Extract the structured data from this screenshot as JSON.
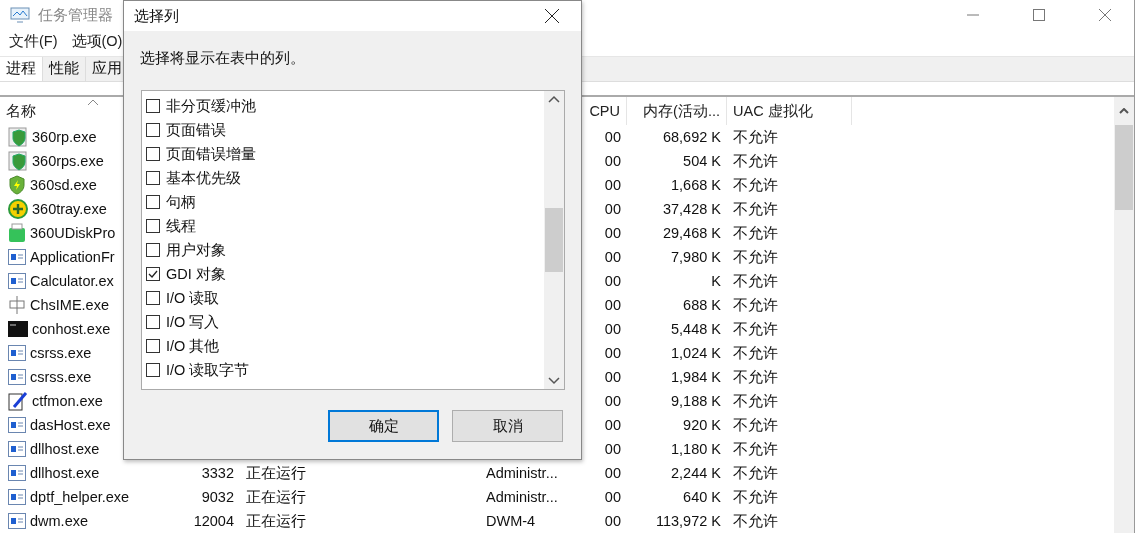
{
  "window": {
    "title": "任务管理器"
  },
  "menu": [
    "文件(F)",
    "选项(O)"
  ],
  "tabs": [
    {
      "label": "进程",
      "selected": true
    },
    {
      "label": "性能",
      "selected": false
    },
    {
      "label": "应用",
      "selected": false
    }
  ],
  "table": {
    "columns": [
      "名称",
      "CPU",
      "内存(活动...",
      "UAC 虚拟化"
    ],
    "rows": [
      {
        "kind": "shield-window",
        "name": "360rp.exe",
        "cpu": "00",
        "memory": "68,692 K",
        "uac": "不允许"
      },
      {
        "kind": "shield-window",
        "name": "360rps.exe",
        "cpu": "00",
        "memory": "504 K",
        "uac": "不允许"
      },
      {
        "kind": "shield",
        "name": "360sd.exe",
        "cpu": "00",
        "memory": "1,668 K",
        "uac": "不允许"
      },
      {
        "kind": "tray",
        "name": "360tray.exe",
        "cpu": "00",
        "memory": "37,428 K",
        "uac": "不允许"
      },
      {
        "kind": "usb",
        "name": "360UDiskPro",
        "cpu": "00",
        "memory": "29,468 K",
        "uac": "不允许"
      },
      {
        "kind": "app",
        "name": "ApplicationFr",
        "cpu": "00",
        "memory": "7,980 K",
        "uac": "不允许"
      },
      {
        "kind": "app",
        "name": "Calculator.ex",
        "cpu": "00",
        "memory": "K",
        "uac": "不允许"
      },
      {
        "kind": "ime",
        "name": "ChsIME.exe",
        "cpu": "00",
        "memory": "688 K",
        "uac": "不允许"
      },
      {
        "kind": "console",
        "name": "conhost.exe",
        "cpu": "00",
        "memory": "5,448 K",
        "uac": "不允许"
      },
      {
        "kind": "app",
        "name": "csrss.exe",
        "cpu": "00",
        "memory": "1,024 K",
        "uac": "不允许"
      },
      {
        "kind": "app",
        "name": "csrss.exe",
        "cpu": "00",
        "memory": "1,984 K",
        "uac": "不允许"
      },
      {
        "kind": "pen",
        "name": "ctfmon.exe",
        "cpu": "00",
        "memory": "9,188 K",
        "uac": "不允许"
      },
      {
        "kind": "app",
        "name": "dasHost.exe",
        "cpu": "00",
        "memory": "920 K",
        "uac": "不允许"
      },
      {
        "kind": "app",
        "name": "dllhost.exe",
        "cpu": "00",
        "memory": "1,180 K",
        "uac": "不允许"
      },
      {
        "kind": "app",
        "name": "dllhost.exe",
        "pid": "3332",
        "status": "正在运行",
        "user": "Administr...",
        "cpu": "00",
        "memory": "2,244 K",
        "uac": "不允许"
      },
      {
        "kind": "app",
        "name": "dptf_helper.exe",
        "pid": "9032",
        "status": "正在运行",
        "user": "Administr...",
        "cpu": "00",
        "memory": "640 K",
        "uac": "不允许"
      },
      {
        "kind": "app",
        "name": "dwm.exe",
        "pid": "12004",
        "status": "正在运行",
        "user": "DWM-4",
        "cpu": "00",
        "memory": "113,972 K",
        "uac": "不允许"
      }
    ]
  },
  "dialog": {
    "title": "选择列",
    "message": "选择将显示在表中的列。",
    "options": [
      {
        "label": "非分页缓冲池",
        "checked": false
      },
      {
        "label": "页面错误",
        "checked": false
      },
      {
        "label": "页面错误增量",
        "checked": false
      },
      {
        "label": "基本优先级",
        "checked": false
      },
      {
        "label": "句柄",
        "checked": false
      },
      {
        "label": "线程",
        "checked": false
      },
      {
        "label": "用户对象",
        "checked": false
      },
      {
        "label": "GDI 对象",
        "checked": true
      },
      {
        "label": "I/O 读取",
        "checked": false
      },
      {
        "label": "I/O 写入",
        "checked": false
      },
      {
        "label": "I/O 其他",
        "checked": false
      },
      {
        "label": "I/O 读取字节",
        "checked": false
      }
    ],
    "buttons": [
      {
        "label": "确定",
        "selected": true
      },
      {
        "label": "取消",
        "selected": false
      }
    ]
  }
}
